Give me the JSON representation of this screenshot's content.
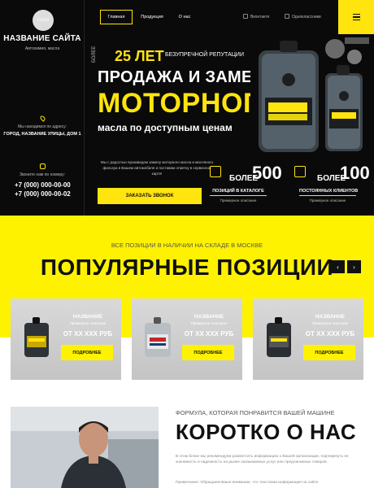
{
  "sidebar": {
    "logo_text": "LOGO",
    "title": "НАЗВАНИЕ САЙТА",
    "subtitle": "Автохимия, масла",
    "address_label": "Мы находимся по адресу:",
    "address": "ГОРОД, НАЗВАНИЕ УЛИЦЫ, ДОМ 1",
    "call_label": "Звоните нам по номеру:",
    "phones": [
      "+7 (000) 000-00-00",
      "+7 (000) 000-00-02"
    ]
  },
  "nav": {
    "items": [
      "Главная",
      "Продукция",
      "О нас"
    ],
    "social": [
      "Вконтакте",
      "Одноклассники"
    ]
  },
  "hero": {
    "vertical": "БОЛЕЕ",
    "years": "25 ЛЕТ",
    "years_sub": "БЕЗУПРЕЧНОЙ РЕПУТАЦИИ",
    "line1": "ПРОДАЖА И ЗАМЕНА",
    "line2": "МОТОРНОГО",
    "line3": "масла по доступным ценам",
    "text": "Мы с радостью произведем замену моторного масла и масляного фильтра в Вашем автомобиле и поставим отметку в сервисной карте!",
    "cta": "Заказать звонок",
    "stats": [
      {
        "pre": "БОЛЕЕ",
        "num": "500",
        "title": "позиций в каталоге",
        "desc": "Примерное описание"
      },
      {
        "pre": "БОЛЕЕ",
        "num": "100",
        "title": "постоянных клиентов",
        "desc": "Примерное описание"
      }
    ]
  },
  "popular": {
    "kicker": "ВСЕ ПОЗИЦИИ В НАЛИЧИИ НА СКЛАДЕ В МОСКВЕ",
    "title": "ПОПУЛЯРНЫЕ ПОЗИЦИИ",
    "prev": "‹",
    "next": "›",
    "cards": [
      {
        "name": "НАЗВАНИЕ",
        "brand": "Примерное описание",
        "price": "ОТ ХХ ХХХ РУБ",
        "button": "ПОДРОБНЕЕ"
      },
      {
        "name": "НАЗВАНИЕ",
        "brand": "Примерное описание",
        "price": "ОТ ХХ ХХХ РУБ",
        "button": "ПОДРОБНЕЕ"
      },
      {
        "name": "НАЗВАНИЕ",
        "brand": "Примерное описание",
        "price": "ОТ ХХ ХХХ РУБ",
        "button": "ПОДРОБНЕЕ"
      }
    ]
  },
  "about": {
    "kicker": "ФОРМУЛА, КОТОРАЯ ПОНРАВИТСЯ ВАШЕЙ МАШИНЕ",
    "title": "КОРОТКО О НАС",
    "text": "В этом блоке мы рекомендуем разместить информацию о Вашей организации, подчеркнуть ее значимость и надежность на рынке оказываемых услуг или предлагаемых товаров.",
    "note": "Примечание: Обращаем Ваше внимание, что текстовая информация на сайте"
  },
  "colors": {
    "accent": "#ffe40d",
    "dark": "#0a0a0a"
  }
}
